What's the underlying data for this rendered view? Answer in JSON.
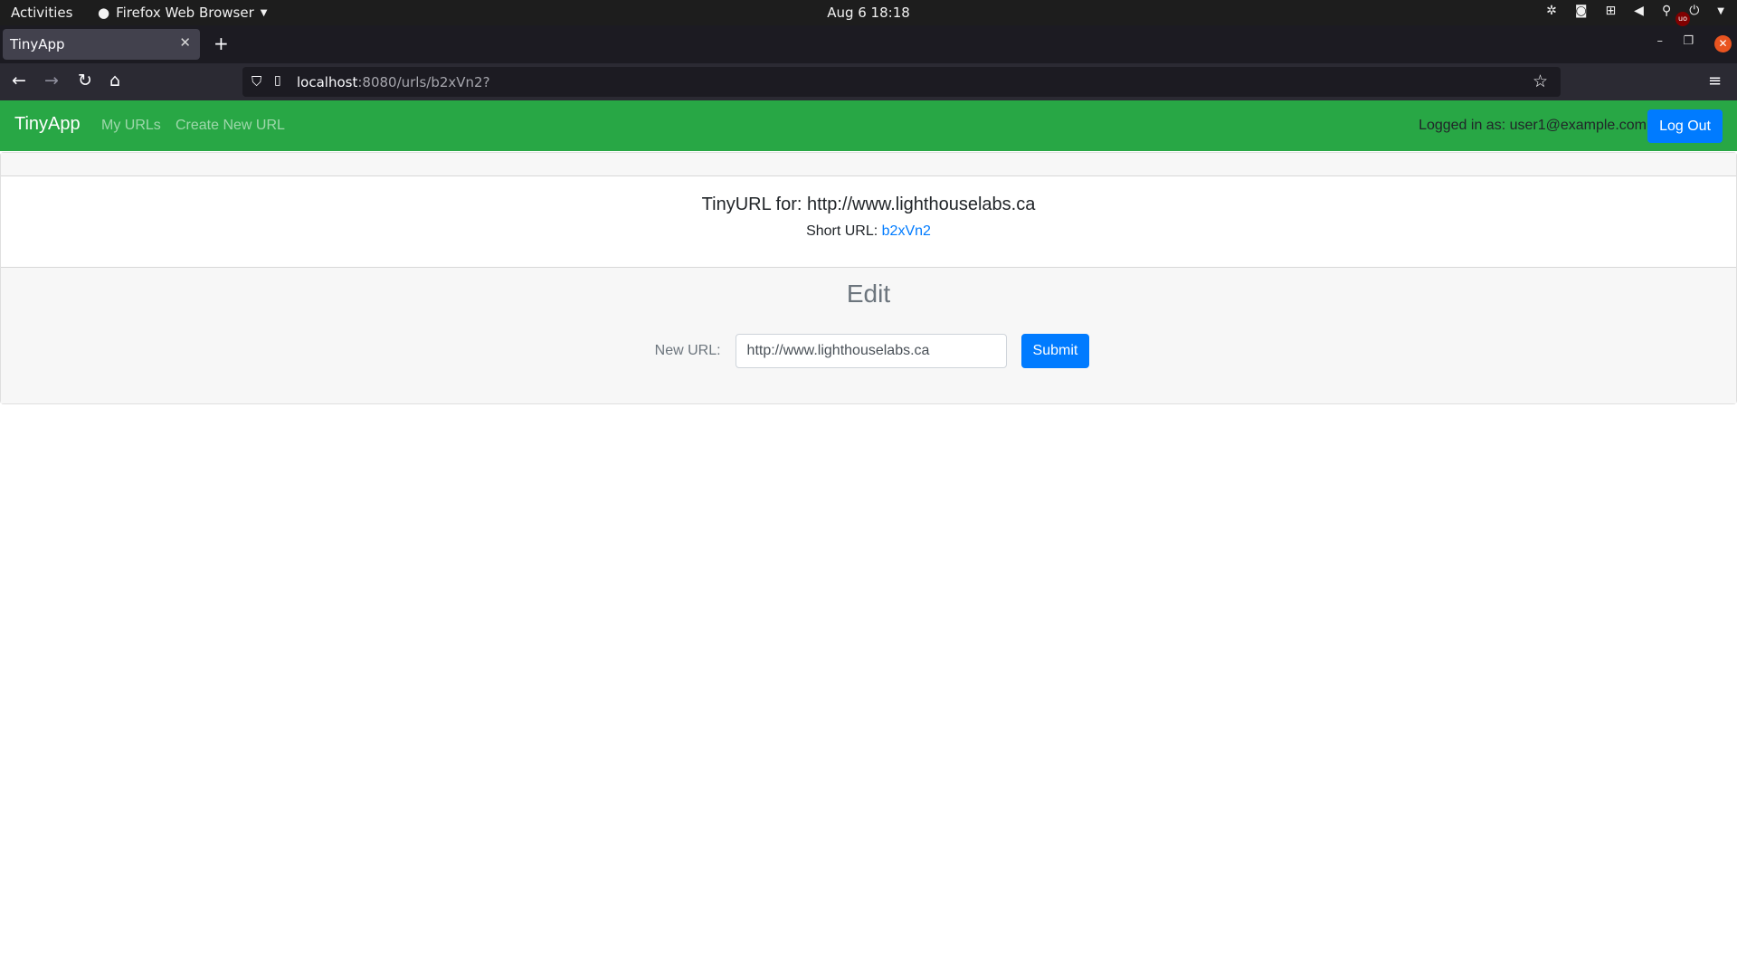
{
  "system_bar": {
    "activities": "Activities",
    "app_name": "Firefox Web Browser",
    "clock": "Aug 6  18:18"
  },
  "browser": {
    "tab_title": "TinyApp",
    "url_host": "localhost",
    "url_rest": ":8080/urls/b2xVn2?",
    "ublock_label": "uo"
  },
  "app": {
    "brand": "TinyApp",
    "nav": {
      "my_urls": "My URLs",
      "create_new_url": "Create New URL"
    },
    "user": {
      "logged_in_text": "Logged in as: user1@example.com",
      "logout_label": "Log Out"
    },
    "url_card": {
      "title": "TinyURL for: http://www.lighthouselabs.ca",
      "short_url_label": "Short URL:",
      "short_url_value": "b2xVn2"
    },
    "edit": {
      "heading": "Edit",
      "new_url_label": "New URL:",
      "new_url_value": "http://www.lighthouselabs.ca",
      "submit_label": "Submit"
    }
  },
  "colors": {
    "navbar": "#28a745",
    "primary": "#007bff",
    "footer_bg": "#f7f7f7"
  }
}
